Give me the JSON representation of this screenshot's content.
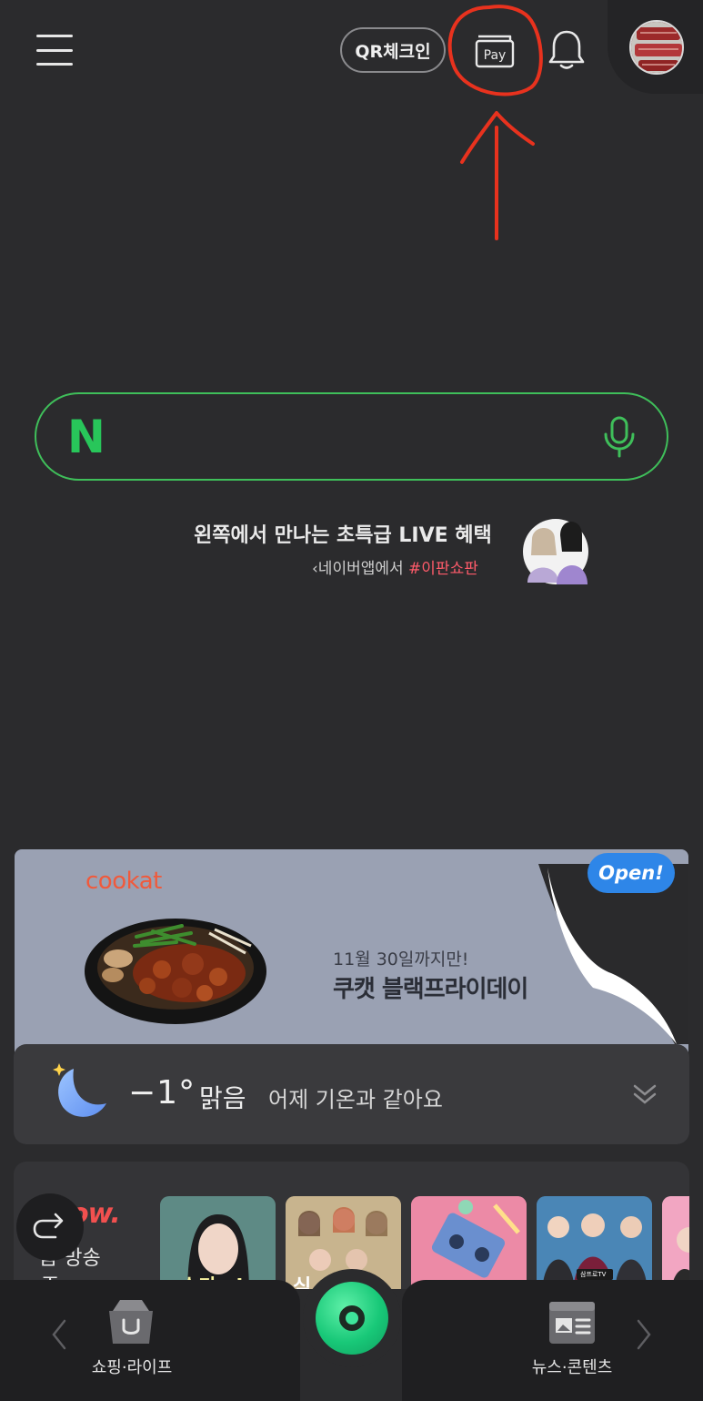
{
  "header": {
    "qr_checkin_label": "QR체크인",
    "pay_label": "Pay"
  },
  "search": {
    "logo": "N",
    "placeholder": ""
  },
  "promo": {
    "title": "왼쪽에서 만나는 초특급 LIVE 혜택",
    "sub_prefix": "‹네이버앱에서 ",
    "sub_highlight": "#이판쇼판"
  },
  "banner": {
    "brand": "cookat",
    "date": "11월 30일까지만!",
    "title": "쿠캣 블랙프라이데이",
    "badge": "Open!"
  },
  "weather": {
    "temperature": "−1°",
    "condition": "맑음",
    "description": "어제 기온과 같아요"
  },
  "now": {
    "logo": "ow.",
    "label_line1": "음 방송",
    "label_line2": "즈",
    "thumbnails": [
      {
        "caption": "슈가.zip"
      },
      {
        "caption": "심"
      },
      {
        "caption": ""
      },
      {
        "caption": "삼프로TV"
      },
      {
        "caption": ""
      }
    ]
  },
  "bottom_nav": {
    "shopping_label": "쇼핑·라이프",
    "news_label": "뉴스·콘텐츠"
  },
  "colors": {
    "background": "#2b2b2d",
    "accent_green": "#28c65a",
    "annotation_red": "#e8321e",
    "highlight_pink": "#ff5b6a"
  }
}
